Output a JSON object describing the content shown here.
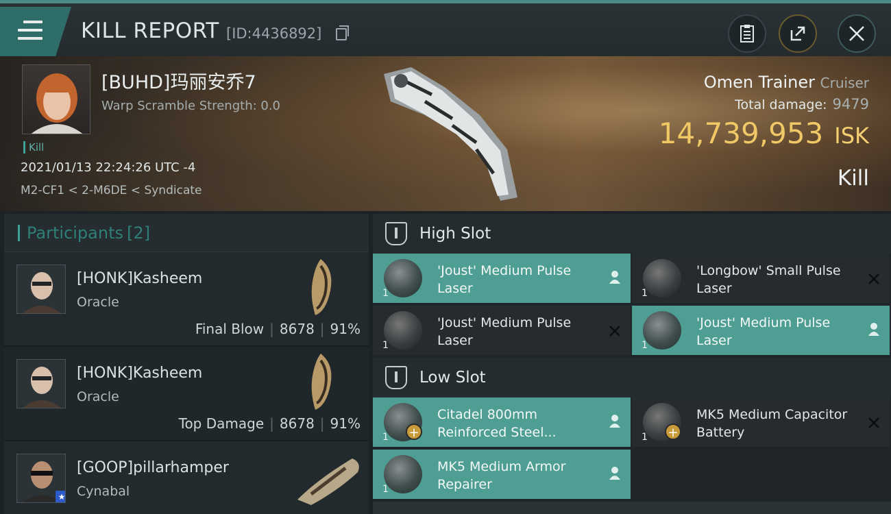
{
  "header": {
    "title": "KILL REPORT",
    "report_id": "[ID:4436892]"
  },
  "victim": {
    "name": "[BUHD]玛丽安乔7",
    "warp_scramble": "Warp Scramble Strength: 0.0",
    "kill_tag": "Kill",
    "datetime": "2021/01/13 22:24:26 UTC -4",
    "location": "M2-CF1 < 2-M6DE < Syndicate",
    "ship_name": "Omen Trainer",
    "ship_class": "Cruiser",
    "total_damage_label": "Total damage:",
    "total_damage": "9479",
    "isk_value": "14,739,953",
    "isk_unit": "ISK",
    "result": "Kill"
  },
  "participants": {
    "label": "Participants",
    "count": "[2]",
    "rows": [
      {
        "name": "[HONK]Kasheem",
        "ship": "Oracle",
        "role": "Final Blow",
        "damage": "8678",
        "percent": "91%"
      },
      {
        "name": "[HONK]Kasheem",
        "ship": "Oracle",
        "role": "Top Damage",
        "damage": "8678",
        "percent": "91%"
      },
      {
        "name": "[GOOP]pillarhamper",
        "ship": "Cynabal",
        "badge": "★"
      }
    ]
  },
  "fitting": {
    "high_slot": {
      "label": "High Slot",
      "modules": [
        {
          "name": "'Joust' Medium Pulse Laser",
          "qty": "1",
          "state": "dropped"
        },
        {
          "name": "'Longbow' Small Pulse Laser",
          "qty": "1",
          "state": "destroyed"
        },
        {
          "name": "'Joust' Medium Pulse Laser",
          "qty": "1",
          "state": "destroyed"
        },
        {
          "name": "'Joust' Medium Pulse Laser",
          "qty": "1",
          "state": "dropped"
        }
      ]
    },
    "low_slot": {
      "label": "Low Slot",
      "modules": [
        {
          "name": "Citadel 800mm Reinforced Steel...",
          "qty": "1",
          "state": "dropped",
          "plus": "+"
        },
        {
          "name": "MK5 Medium Capacitor Battery",
          "qty": "1",
          "state": "destroyed",
          "plus": "+"
        },
        {
          "name": "MK5 Medium Armor Repairer",
          "qty": "1",
          "state": "dropped"
        }
      ]
    }
  },
  "icons": {
    "dropped": "person-icon",
    "destroyed": "x-icon"
  },
  "colors": {
    "accent": "#4e9e93",
    "isk": "#f1c866",
    "topbar_accent": "#2f6d69"
  }
}
